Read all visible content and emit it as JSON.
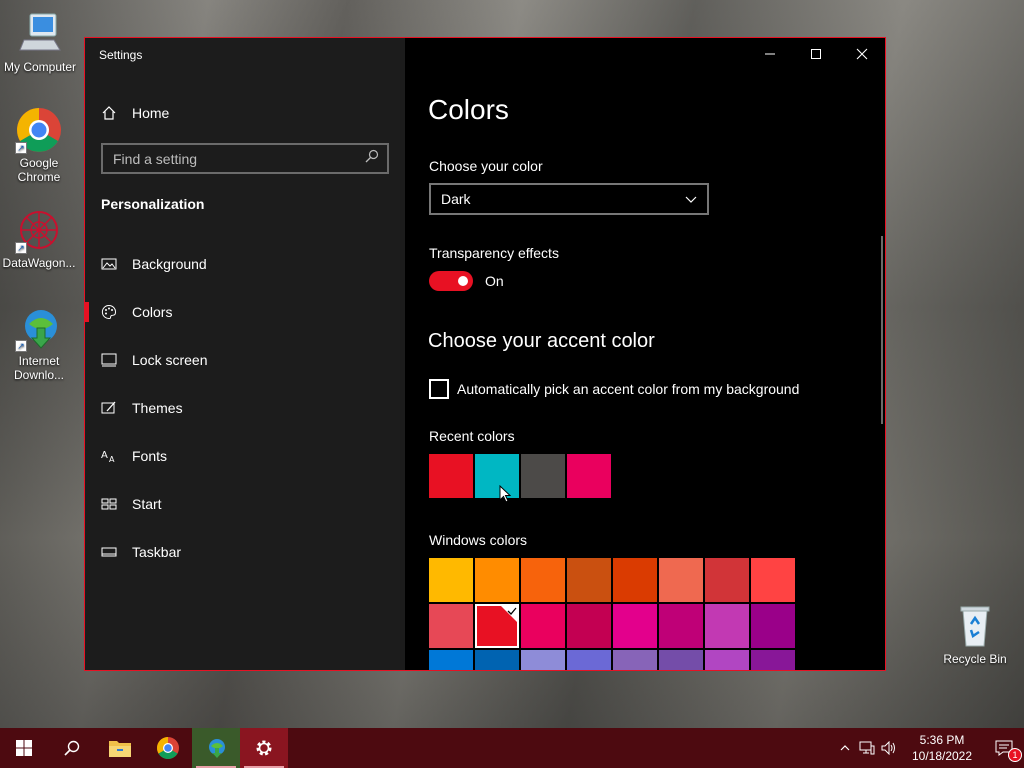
{
  "desktop": {
    "icons": [
      {
        "label": "My Computer",
        "icon": "computer-icon"
      },
      {
        "label": "Google Chrome",
        "icon": "chrome-icon"
      },
      {
        "label": "DataWagon...",
        "icon": "datawagon-icon"
      },
      {
        "label": "Internet Downlo...",
        "icon": "idm-icon"
      },
      {
        "label": "Recycle Bin",
        "icon": "recycle-bin-icon"
      }
    ]
  },
  "window": {
    "title": "Settings",
    "accent": "#e81123",
    "controls": {
      "minimize": "minimize-icon",
      "maximize": "maximize-icon",
      "close": "close-icon"
    }
  },
  "sidebar": {
    "home_label": "Home",
    "search_placeholder": "Find a setting",
    "section": "Personalization",
    "items": [
      {
        "label": "Background",
        "icon": "picture-icon"
      },
      {
        "label": "Colors",
        "icon": "palette-icon",
        "active": true
      },
      {
        "label": "Lock screen",
        "icon": "lock-screen-icon"
      },
      {
        "label": "Themes",
        "icon": "themes-icon"
      },
      {
        "label": "Fonts",
        "icon": "fonts-icon"
      },
      {
        "label": "Start",
        "icon": "start-icon"
      },
      {
        "label": "Taskbar",
        "icon": "taskbar-icon"
      }
    ]
  },
  "content": {
    "title": "Colors",
    "choose_color_label": "Choose your color",
    "choose_color_value": "Dark",
    "transparency_label": "Transparency effects",
    "transparency_state": "On",
    "accent_title": "Choose your accent color",
    "auto_pick_label": "Automatically pick an accent color from my background",
    "recent_label": "Recent colors",
    "recent_colors": [
      "#e81123",
      "#00b7c3",
      "#4c4a48",
      "#ea005e"
    ],
    "windows_label": "Windows colors",
    "windows_colors": [
      [
        "#ffb900",
        "#ff8c00",
        "#f7630c",
        "#ca5010",
        "#da3b01",
        "#ef6950",
        "#d13438",
        "#ff4343"
      ],
      [
        "#e74856",
        "#e81123",
        "#ea005e",
        "#c30052",
        "#e3008c",
        "#bf0077",
        "#c239b3",
        "#9a0089"
      ],
      [
        "#0078d7",
        "#0063b1",
        "#8e8cd8",
        "#6b69d6",
        "#8764b8",
        "#744da9",
        "#b146c2",
        "#881798"
      ]
    ],
    "selected_windows_color": "#e81123"
  },
  "taskbar": {
    "apps": [
      {
        "icon": "windows-start-icon"
      },
      {
        "icon": "search-icon"
      },
      {
        "icon": "file-explorer-icon"
      },
      {
        "icon": "chrome-icon"
      },
      {
        "icon": "idm-icon"
      },
      {
        "icon": "settings-gear-icon"
      }
    ],
    "time": "5:36 PM",
    "date": "10/18/2022",
    "notification_count": "1"
  }
}
